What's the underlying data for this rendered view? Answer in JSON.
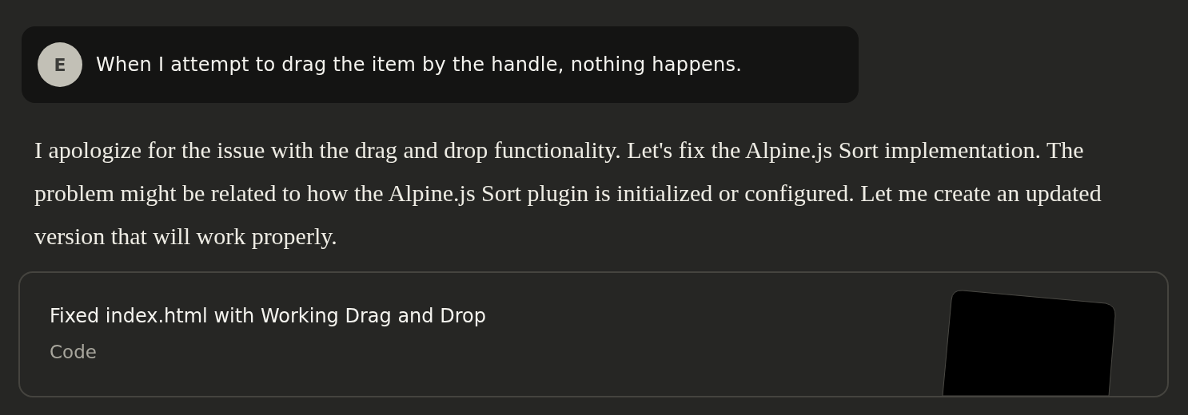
{
  "user_message": {
    "avatar_initial": "E",
    "text": "When I attempt to drag the item by the handle, nothing happens."
  },
  "assistant_message": {
    "text": "I apologize for the issue with the drag and drop functionality. Let's fix the Alpine.js Sort implementation. The problem might be related to how the Alpine.js Sort plugin is initialized or configured. Let me create an updated version that will work properly."
  },
  "artifact": {
    "title": "Fixed index.html with Working Drag and Drop",
    "type": "Code"
  }
}
